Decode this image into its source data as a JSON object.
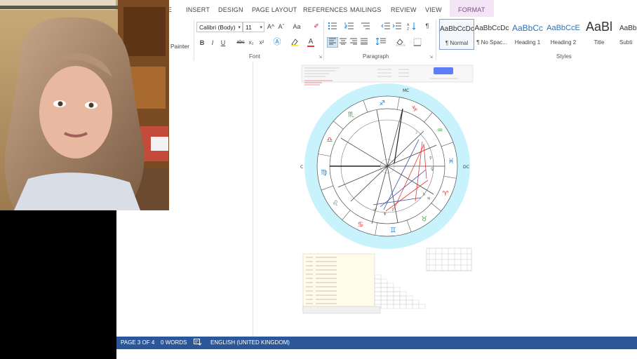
{
  "ribbon_tabs": {
    "e_partial": "E",
    "insert": "INSERT",
    "design": "DESIGN",
    "page_layout": "PAGE LAYOUT",
    "references": "REFERENCES",
    "mailings": "MAILINGS",
    "review": "REVIEW",
    "view": "VIEW",
    "format": "FORMAT"
  },
  "clipboard": {
    "format_painter_label": "Painter"
  },
  "font_group": {
    "label": "Font",
    "font_name": "Calibri (Body)",
    "font_size": "11",
    "grow_icon": "A^",
    "shrink_icon": "Aˇ",
    "change_case": "Aa",
    "bold": "B",
    "italic": "I",
    "underline": "U",
    "strikethrough": "abc",
    "subscript": "x₂",
    "superscript": "x²",
    "font_color_letter": "A"
  },
  "paragraph_group": {
    "label": "Paragraph",
    "pilcrow": "¶"
  },
  "styles_group": {
    "label": "Styles",
    "items": [
      {
        "sample": "AaBbCcDc",
        "name": "¶ Normal"
      },
      {
        "sample": "AaBbCcDc",
        "name": "¶ No Spac..."
      },
      {
        "sample": "AaBbCc",
        "name": "Heading 1"
      },
      {
        "sample": "AaBbCcE",
        "name": "Heading 2"
      },
      {
        "sample": "AaBl",
        "name": "Title"
      },
      {
        "sample": "AaBb",
        "name": "Subti"
      }
    ]
  },
  "statusbar": {
    "page": "PAGE 3 OF 4",
    "words": "0 WORDS",
    "language": "ENGLISH (UNITED KINGDOM)"
  },
  "colors": {
    "statusbar": "#2b579a",
    "format_tab_bg": "#f3e5f5",
    "format_tab_text": "#7b4a8a",
    "wheel_outer": "#bff0fb",
    "aspect_red": "#e53935",
    "aspect_blue": "#3949ab"
  },
  "chart": {
    "zodiac_glyphs": [
      "♈",
      "♉",
      "♊",
      "♋",
      "♌",
      "♍",
      "♎",
      "♏",
      "♐",
      "♑",
      "♒",
      "♓"
    ],
    "angle_ac": "AC",
    "angle_mc": "MC",
    "angle_dc": "DC"
  }
}
